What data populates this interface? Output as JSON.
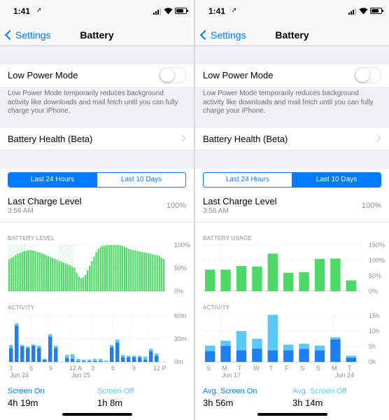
{
  "colors": {
    "accent": "#007aff",
    "battery_green": "#4cd964",
    "activity_dark": "#1f7ff0",
    "activity_light": "#5ac8fa",
    "screen_off_text": "#5ac8fa",
    "grid": "#c8c8cd"
  },
  "icons": [
    "location-icon",
    "signal-icon",
    "wifi-icon",
    "battery-icon",
    "chevron-left-icon",
    "chevron-right-icon",
    "charging-bolt-icon"
  ],
  "left": {
    "status": {
      "time": "1:41",
      "loc": "➚"
    },
    "nav": {
      "back": "Settings",
      "title": "Battery"
    },
    "lpm": {
      "label": "Low Power Mode",
      "on": false
    },
    "footnote": "Low Power Mode temporarily reduces background activity like downloads and mail fetch until you can fully charge your iPhone.",
    "health": "Battery Health (Beta)",
    "tabs": [
      {
        "label": "Last 24 Hours",
        "active": true
      },
      {
        "label": "Last 10 Days",
        "active": false
      }
    ],
    "lcl": {
      "title": "Last Charge Level",
      "time": "3:56 AM",
      "value": "100%"
    },
    "charts": {
      "level_title": "BATTERY LEVEL",
      "activity_title": "ACTIVITY"
    },
    "stats": [
      {
        "label": "Screen On",
        "value": "4h 19m"
      },
      {
        "label": "Screen Off",
        "value": "1h 8m"
      }
    ]
  },
  "right": {
    "status": {
      "time": "1:41",
      "loc": "➚"
    },
    "nav": {
      "back": "Settings",
      "title": "Battery"
    },
    "lpm": {
      "label": "Low Power Mode",
      "on": false
    },
    "footnote": "Low Power Mode temporarily reduces background activity like downloads and mail fetch until you can fully charge your iPhone.",
    "health": "Battery Health (Beta)",
    "tabs": [
      {
        "label": "Last 24 Hours",
        "active": false
      },
      {
        "label": "Last 10 Days",
        "active": true
      }
    ],
    "lcl": {
      "title": "Last Charge Level",
      "time": "3:56 AM",
      "value": "100%"
    },
    "charts": {
      "level_title": "BATTERY USAGE",
      "activity_title": "ACTIVITY"
    },
    "stats": [
      {
        "label": "Avg. Screen On",
        "value": "3h 56m"
      },
      {
        "label": "Avg. Screen Off",
        "value": "3h 14m"
      }
    ]
  },
  "chart_data": [
    {
      "type": "bar",
      "title": "BATTERY LEVEL",
      "y_ticks": [
        "100%",
        "50%",
        "0%"
      ],
      "ylim": [
        0,
        100
      ],
      "unit": "%",
      "bar_count": 72,
      "values": [
        69,
        72,
        75,
        78,
        81,
        83,
        85,
        87,
        88,
        89,
        89,
        88,
        87,
        85,
        84,
        82,
        80,
        78,
        76,
        74,
        72,
        70,
        68,
        66,
        64,
        62,
        60,
        58,
        56,
        53,
        50,
        40,
        32,
        28,
        30,
        35,
        45,
        55,
        65,
        75,
        85,
        92,
        96,
        98,
        99,
        100,
        100,
        100,
        100,
        100,
        100,
        99,
        98,
        96,
        94,
        92,
        90,
        89,
        88,
        87,
        86,
        85,
        84,
        83,
        82,
        81,
        80,
        79,
        78,
        76,
        72,
        70
      ],
      "charging_hatch_ranges": [
        [
          0,
          2.75
        ],
        [
          7.6,
          10
        ]
      ]
    },
    {
      "type": "bar",
      "title": "ACTIVITY",
      "y_ticks": [
        "60m",
        "30m",
        "0m"
      ],
      "ylim": [
        0,
        60
      ],
      "unit": "min",
      "x_tick_labels": [
        "3",
        "6",
        "9",
        "12 A",
        "3",
        "6",
        "9",
        "12 P"
      ],
      "x_sublabels": [
        "Jun 24",
        "Jun 25"
      ],
      "series": [
        {
          "name": "Screen On",
          "values": [
            18,
            47,
            20,
            18,
            21,
            18,
            3,
            33,
            18,
            0,
            5,
            4,
            1,
            1,
            1,
            1,
            1,
            0,
            19,
            25,
            6,
            6,
            6,
            6,
            3,
            14,
            8,
            0
          ]
        },
        {
          "name": "Screen Off",
          "values": [
            4,
            3,
            2,
            2,
            2,
            3,
            1,
            3,
            3,
            0,
            4,
            6,
            3,
            2,
            2,
            3,
            3,
            2,
            3,
            4,
            3,
            2,
            2,
            2,
            4,
            3,
            3,
            0
          ]
        }
      ]
    },
    {
      "type": "bar",
      "title": "BATTERY USAGE",
      "y_ticks": [
        "150%",
        "100%",
        "50%",
        "0%"
      ],
      "ylim": [
        0,
        150
      ],
      "unit": "%",
      "categories": [
        "S",
        "M",
        "T",
        "W",
        "T",
        "F",
        "S",
        "S",
        "M",
        "T"
      ],
      "values": [
        70,
        70,
        82,
        80,
        122,
        60,
        62,
        105,
        106,
        35
      ]
    },
    {
      "type": "bar",
      "title": "ACTIVITY",
      "y_ticks": [
        "15h",
        "10h",
        "5h",
        "0h"
      ],
      "ylim": [
        0,
        15
      ],
      "unit": "h",
      "categories": [
        "S",
        "M",
        "T",
        "W",
        "T",
        "F",
        "S",
        "S",
        "M",
        "T"
      ],
      "x_sublabels": [
        "Jun 17",
        "Jun 24"
      ],
      "series": [
        {
          "name": "Screen On",
          "values": [
            3.5,
            5.2,
            3.8,
            4.3,
            3.8,
            3.8,
            4.2,
            3.8,
            7.3,
            1.4
          ]
        },
        {
          "name": "Screen Off",
          "values": [
            1.8,
            1.7,
            6.2,
            3.2,
            11.5,
            1.8,
            1.7,
            1.5,
            0.7,
            0.6
          ]
        }
      ]
    }
  ]
}
